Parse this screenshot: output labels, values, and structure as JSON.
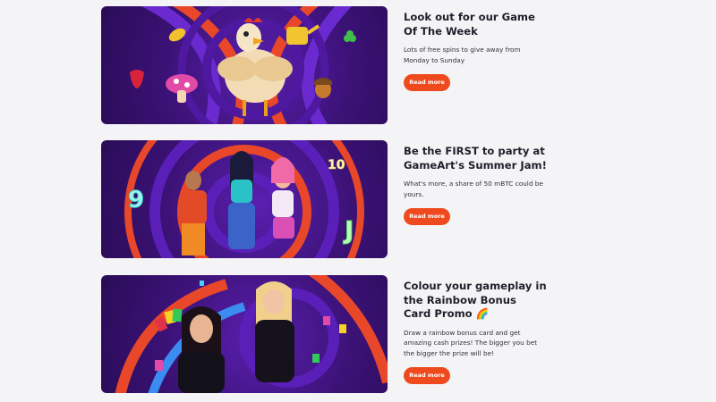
{
  "promotions": [
    {
      "title": "Look out for our Game Of The Week",
      "description": "Lots of free spins to give away from Monday to Sunday",
      "button_label": "Read more",
      "banner_icon": "rooster-slot-banner"
    },
    {
      "title": "Be the FIRST to party at GameArt's Summer Jam!",
      "description": "What's more, a share of 50 mBTC could be yours.",
      "button_label": "Read more",
      "banner_icon": "summer-jam-party-banner",
      "banner_symbols": [
        "9",
        "10",
        "J"
      ]
    },
    {
      "title": "Colour your gameplay in the Rainbow Bonus Card Promo 🌈",
      "description": "Draw a rainbow bonus card and get amazing cash prizes! The bigger you bet the bigger the prize will be!",
      "button_label": "Read more",
      "banner_icon": "rainbow-card-dealers-banner"
    }
  ],
  "colors": {
    "button": "#ef4a1e",
    "banner_purple": "#3b1276",
    "background": "#f4f4f6",
    "title": "#1f1f2b"
  }
}
